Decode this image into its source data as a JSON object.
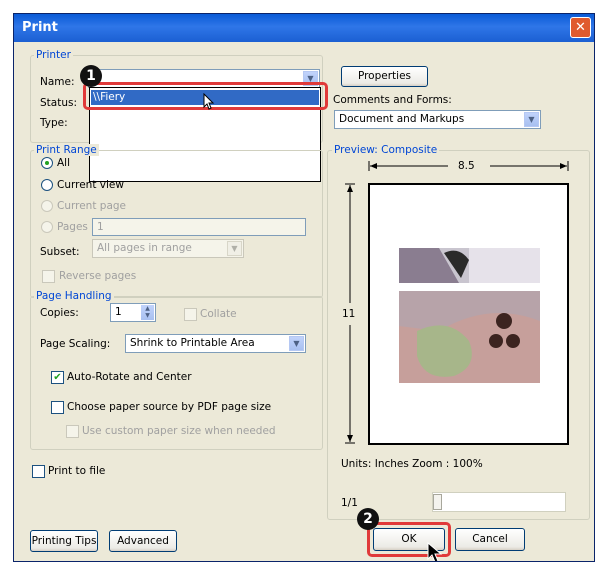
{
  "window": {
    "title": "Print",
    "close_glyph": "✕"
  },
  "printer": {
    "legend": "Printer",
    "name_label": "Name:",
    "status_label": "Status:",
    "type_label": "Type:",
    "dropdown_selected": "\\\\Fiery",
    "properties_button": "Properties",
    "comments_label": "Comments and Forms:",
    "comments_value": "Document and Markups"
  },
  "print_range": {
    "legend": "Print Range",
    "all": "All",
    "current_view": "Current view",
    "current_page": "Current page",
    "pages": "Pages",
    "pages_value": "1",
    "subset_label": "Subset:",
    "subset_value": "All pages in range",
    "reverse_pages": "Reverse pages"
  },
  "page_handling": {
    "legend": "Page Handling",
    "copies_label": "Copies:",
    "copies_value": "1",
    "collate": "Collate",
    "scaling_label": "Page Scaling:",
    "scaling_value": "Shrink to Printable Area",
    "auto_rotate": "Auto-Rotate and Center",
    "paper_source": "Choose paper source by PDF page size",
    "custom_paper": "Use custom paper size when needed"
  },
  "print_to_file": "Print to file",
  "preview": {
    "legend": "Preview: Composite",
    "width_label": "8.5",
    "height_label": "11",
    "units": "Units: Inches Zoom : 100%",
    "page_indicator": "1/1"
  },
  "buttons": {
    "printing_tips": "Printing Tips",
    "advanced": "Advanced",
    "ok": "OK",
    "cancel": "Cancel"
  },
  "callouts": {
    "one": "1",
    "two": "2"
  },
  "colors": {
    "title_bar": "#1b5fd2",
    "highlight": "#e03a3a",
    "legend": "#0046d5",
    "selection": "#316ac5"
  }
}
